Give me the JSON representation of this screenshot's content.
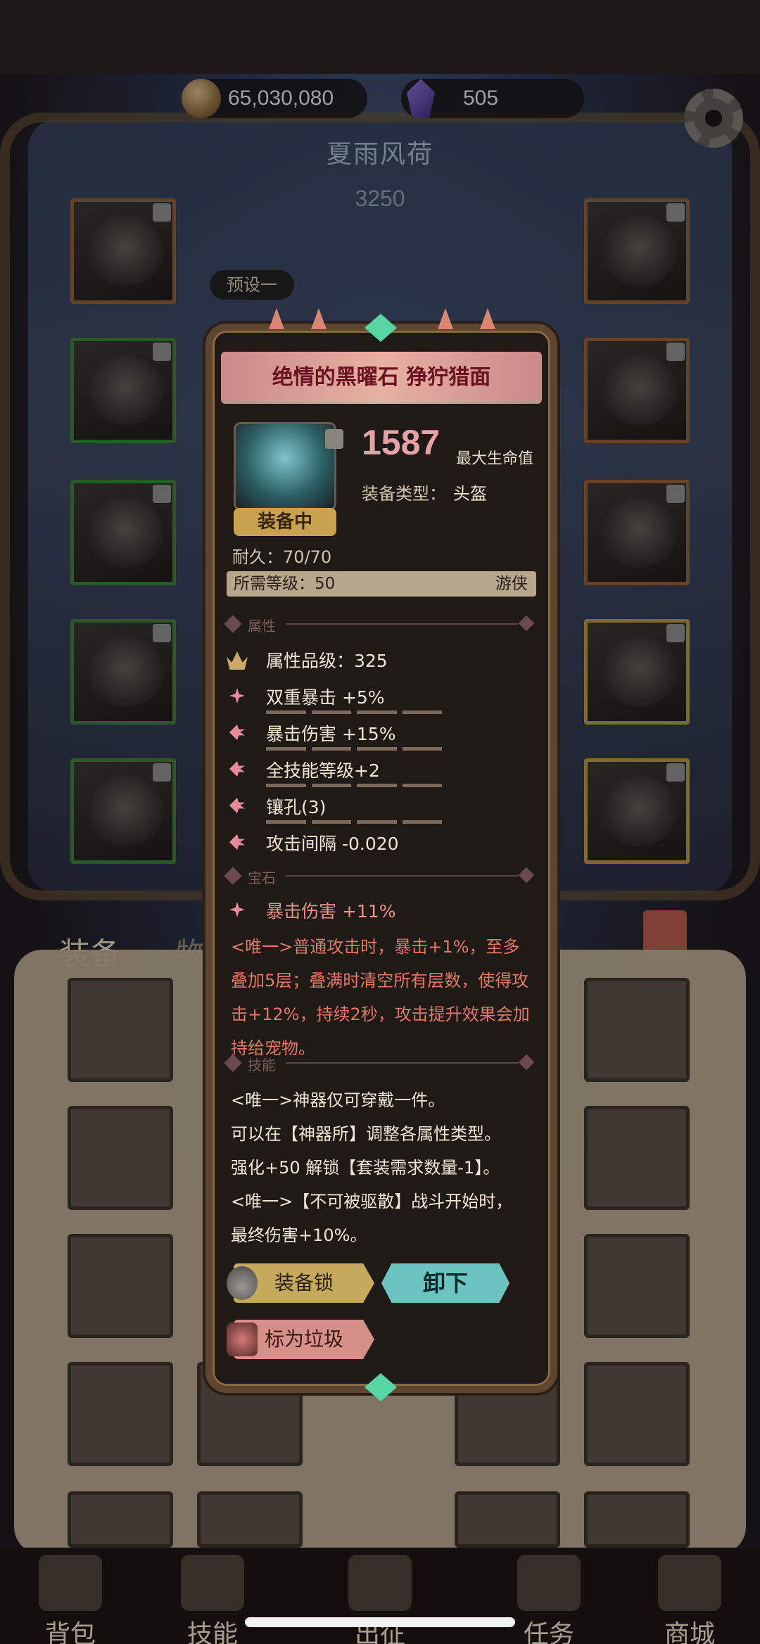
{
  "currency": {
    "gold": "65,030,080",
    "gems": "505"
  },
  "hero": {
    "name": "夏雨风荷",
    "power": "3250",
    "preset": "预设一"
  },
  "inventory": {
    "tab_equip": "装备",
    "tab_items": "物品"
  },
  "nav": [
    {
      "label": "背包",
      "icon": "backpack-icon"
    },
    {
      "label": "技能",
      "icon": "skill-card-icon"
    },
    {
      "label": "出征",
      "icon": "sword-icon"
    },
    {
      "label": "任务",
      "icon": "scroll-icon"
    },
    {
      "label": "商城",
      "icon": "shop-icon"
    }
  ],
  "item": {
    "title": "绝情的黑曜石 狰狞猎面",
    "equipped_tag": "装备中",
    "hp_value": "1587",
    "hp_label": "最大生命值",
    "type_label": "装备类型：",
    "type_value": "头盔",
    "durability": "耐久：70/70",
    "required_level": "所需等级：50",
    "class": "游侠",
    "section_attributes": "属性",
    "section_gems": "宝石",
    "section_skills": "技能",
    "quality": "属性品级：325",
    "stats": [
      "双重暴击 +5%",
      "暴击伤害 +15%",
      "全技能等级+2",
      "镶孔(3)",
      "攻击间隔 -0.020"
    ],
    "gem_stat": "暴击伤害 +11%",
    "unique_effect": "<唯一>普通攻击时，暴击+1%，至多叠加5层；叠满时清空所有层数，使得攻击+12%，持续2秒，攻击提升效果会加持给宠物。",
    "skill_lines": [
      "<唯一>神器仅可穿戴一件。",
      "可以在【神器所】调整各属性类型。",
      "强化+50 解锁【套装需求数量-1】。",
      "<唯一>【不可被驱散】战斗开始时，",
      "最终伤害+10%。"
    ],
    "btn_lock": "装备锁",
    "btn_unequip": "卸下",
    "btn_junk": "标为垃圾"
  },
  "colors": {
    "title_text": "#6a1220",
    "title_banner": "#e8b0a2",
    "hp_value": "#e7a2a6",
    "unique_text": "#e27766",
    "unequip_button": "#6bc4c0",
    "lock_button": "#c4aa5a",
    "junk_button": "#d6908a"
  }
}
